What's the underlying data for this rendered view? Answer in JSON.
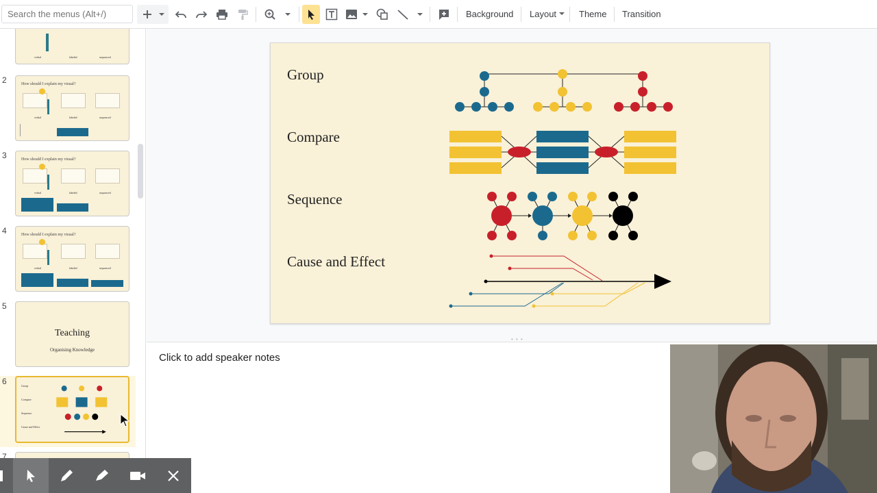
{
  "toolbar": {
    "search_placeholder": "Search the menus (Alt+/)",
    "background_label": "Background",
    "layout_label": "Layout",
    "theme_label": "Theme",
    "transition_label": "Transition"
  },
  "filmstrip": {
    "slides": [
      {
        "number": "2",
        "title": "How should I explain my visual?",
        "captions": [
          "verbal",
          "labeled",
          "sequenced"
        ]
      },
      {
        "number": "3",
        "title": "How should I explain my visual?",
        "captions": [
          "verbal",
          "labeled",
          "sequenced"
        ]
      },
      {
        "number": "4",
        "title": "How should I explain my visual?",
        "captions": [
          "verbal",
          "labeled",
          "sequenced"
        ]
      },
      {
        "number": "5",
        "title": "Teaching",
        "subtitle": "Organising Knowledge"
      },
      {
        "number": "6",
        "labels": [
          "Group",
          "Compare",
          "Sequence",
          "Cause and Effect"
        ]
      },
      {
        "number": "7"
      }
    ],
    "top_partial_captions": [
      "verbal",
      "labeled",
      "sequenced"
    ]
  },
  "slide": {
    "labels": {
      "group": "Group",
      "compare": "Compare",
      "sequence": "Sequence",
      "cause_effect": "Cause and Effect"
    },
    "colors": {
      "background": "#f9f1d8",
      "blue": "#1b6a8e",
      "yellow": "#f2c232",
      "red": "#c8202a",
      "black": "#000000"
    }
  },
  "notes": {
    "placeholder": "Click to add speaker notes"
  },
  "annotation_toolbar": {
    "tools": [
      "pointer-icon",
      "pen-icon",
      "highlighter-icon",
      "camera-icon",
      "close-icon"
    ]
  }
}
